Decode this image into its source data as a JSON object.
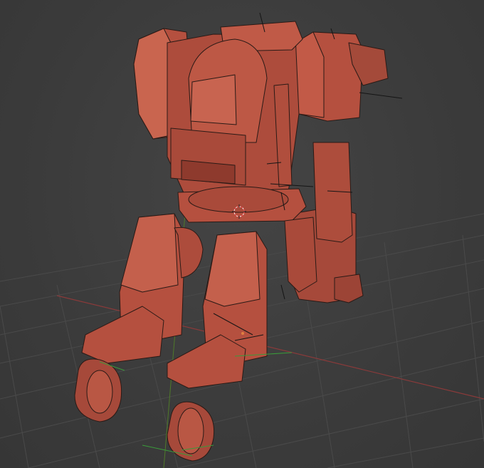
{
  "viewport": {
    "kind": "3d-viewport",
    "colors": {
      "background": "#3d3d3d",
      "grid": "#4a4a4a",
      "x_axis": "#8a3a3a",
      "y_axis": "#4f7a2a",
      "model": "#b5503f",
      "model_shadow": "#8e3a2d",
      "model_highlight": "#c9654f",
      "edge": "#1a1a1a",
      "bone_green": "#3a9a3a",
      "cursor": "#e05050"
    },
    "icons": {
      "cursor": "3d-cursor-icon",
      "model": "mech-robot-model"
    }
  }
}
